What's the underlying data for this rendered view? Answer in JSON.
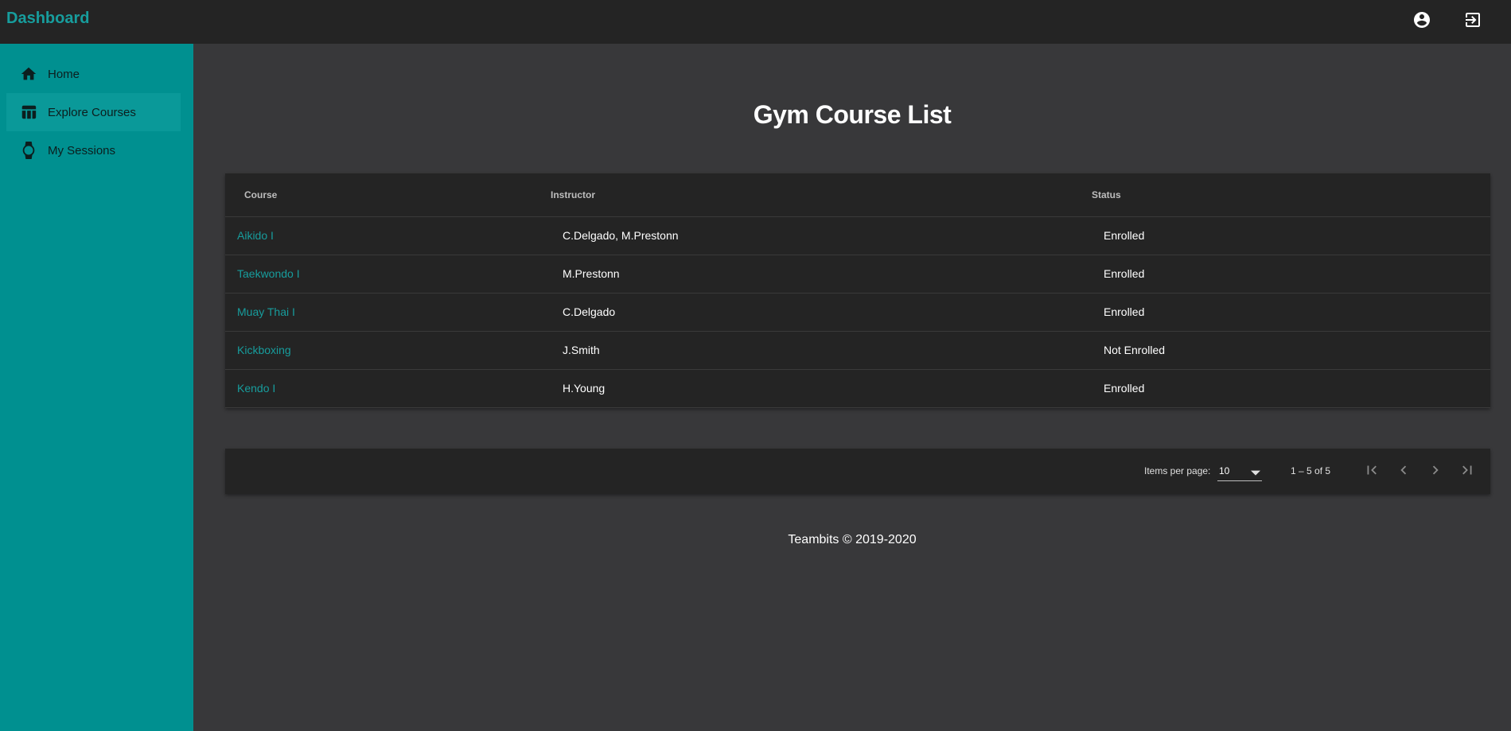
{
  "app": {
    "title": "Dashboard"
  },
  "sidebar": {
    "items": [
      {
        "label": "Home",
        "icon": "home-icon",
        "active": false
      },
      {
        "label": "Explore Courses",
        "icon": "table-icon",
        "active": true
      },
      {
        "label": "My Sessions",
        "icon": "watch-icon",
        "active": false
      }
    ]
  },
  "header_icons": [
    "account-circle-icon",
    "logout-icon"
  ],
  "main": {
    "title": "Gym Course List",
    "table": {
      "columns": [
        "Course",
        "Instructor",
        "Status"
      ],
      "rows": [
        {
          "course": "Aikido I",
          "instructor": "C.Delgado, M.Prestonn",
          "status": "Enrolled"
        },
        {
          "course": "Taekwondo I",
          "instructor": "M.Prestonn",
          "status": "Enrolled"
        },
        {
          "course": "Muay Thai I",
          "instructor": "C.Delgado",
          "status": "Enrolled"
        },
        {
          "course": "Kickboxing",
          "instructor": "J.Smith",
          "status": "Not Enrolled"
        },
        {
          "course": "Kendo I",
          "instructor": "H.Young",
          "status": "Enrolled"
        }
      ]
    },
    "paginator": {
      "items_per_page_label": "Items per page:",
      "items_per_page": "10",
      "range": "1 – 5 of 5"
    }
  },
  "footer": {
    "text": "Teambits © 2019-2020"
  },
  "colors": {
    "accent": "#179d9d",
    "sidebar": "#009090",
    "topbar": "#242424",
    "background": "#38383a"
  }
}
